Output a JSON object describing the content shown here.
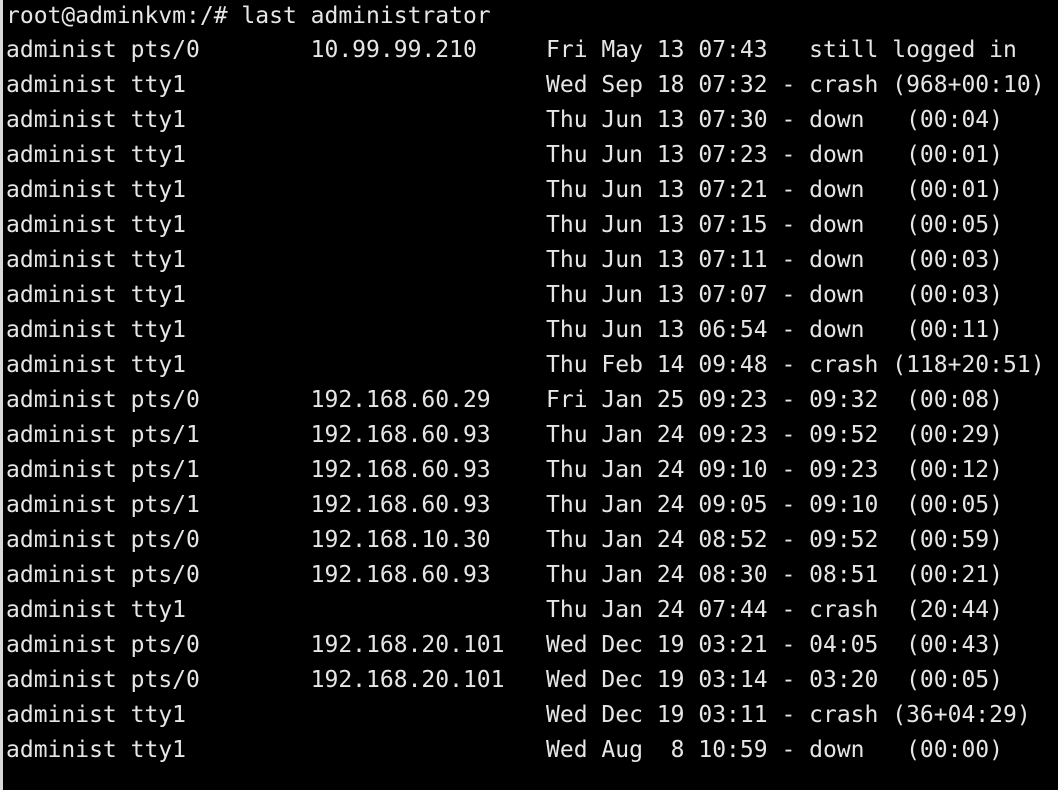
{
  "terminal": {
    "lines": [
      "root@adminkvm:/# last administrator",
      "administ pts/0        10.99.99.210     Fri May 13 07:43   still logged in",
      "administ tty1                          Wed Sep 18 07:32 - crash (968+00:10)",
      "administ tty1                          Thu Jun 13 07:30 - down   (00:04)",
      "administ tty1                          Thu Jun 13 07:23 - down   (00:01)",
      "administ tty1                          Thu Jun 13 07:21 - down   (00:01)",
      "administ tty1                          Thu Jun 13 07:15 - down   (00:05)",
      "administ tty1                          Thu Jun 13 07:11 - down   (00:03)",
      "administ tty1                          Thu Jun 13 07:07 - down   (00:03)",
      "administ tty1                          Thu Jun 13 06:54 - down   (00:11)",
      "administ tty1                          Thu Feb 14 09:48 - crash (118+20:51)",
      "administ pts/0        192.168.60.29    Fri Jan 25 09:23 - 09:32  (00:08)",
      "administ pts/1        192.168.60.93    Thu Jan 24 09:23 - 09:52  (00:29)",
      "administ pts/1        192.168.60.93    Thu Jan 24 09:10 - 09:23  (00:12)",
      "administ pts/1        192.168.60.93    Thu Jan 24 09:05 - 09:10  (00:05)",
      "administ pts/0        192.168.10.30    Thu Jan 24 08:52 - 09:52  (00:59)",
      "administ pts/0        192.168.60.93    Thu Jan 24 08:30 - 08:51  (00:21)",
      "administ tty1                          Thu Jan 24 07:44 - crash  (20:44)",
      "administ pts/0        192.168.20.101   Wed Dec 19 03:21 - 04:05  (00:43)",
      "administ pts/0        192.168.20.101   Wed Dec 19 03:14 - 03:20  (00:05)",
      "administ tty1                          Wed Dec 19 03:11 - crash (36+04:29)",
      "administ tty1                          Wed Aug  8 10:59 - down   (00:00)"
    ]
  },
  "colors": {
    "background": "#000000",
    "foreground": "#e6e6e6"
  }
}
